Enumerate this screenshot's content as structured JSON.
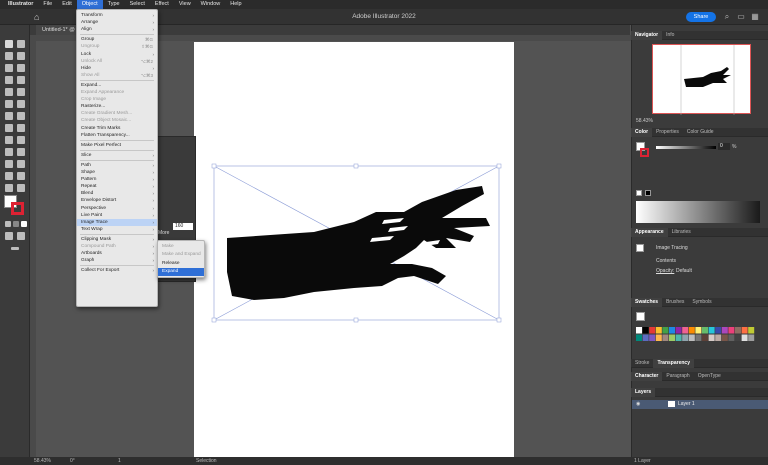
{
  "menubar": {
    "app": "Illustrator",
    "items": [
      "File",
      "Edit",
      "Object",
      "Type",
      "Select",
      "Effect",
      "View",
      "Window",
      "Help"
    ],
    "active": "Object"
  },
  "appbar": {
    "title": "Adobe Illustrator 2022",
    "share_label": "Share"
  },
  "document": {
    "tab_label": "Untitled-1* @"
  },
  "object_menu": {
    "items": [
      {
        "label": "Transform",
        "arrow": true
      },
      {
        "label": "Arrange",
        "arrow": true
      },
      {
        "label": "Align",
        "arrow": true
      },
      {
        "sep": true
      },
      {
        "label": "Group",
        "shortcut": "⌘G"
      },
      {
        "label": "Ungroup",
        "shortcut": "⇧⌘G",
        "disabled": true
      },
      {
        "label": "Lock",
        "arrow": true
      },
      {
        "label": "Unlock All",
        "shortcut": "⌥⌘2",
        "disabled": true
      },
      {
        "label": "Hide",
        "arrow": true
      },
      {
        "label": "Show All",
        "shortcut": "⌥⌘3",
        "disabled": true
      },
      {
        "sep": true
      },
      {
        "label": "Expand..."
      },
      {
        "label": "Expand Appearance",
        "disabled": true
      },
      {
        "label": "Crop Image",
        "disabled": true
      },
      {
        "label": "Rasterize..."
      },
      {
        "label": "Create Gradient Mesh...",
        "disabled": true
      },
      {
        "label": "Create Object Mosaic...",
        "disabled": true
      },
      {
        "label": "Create Trim Marks"
      },
      {
        "label": "Flatten Transparency..."
      },
      {
        "sep": true
      },
      {
        "label": "Make Pixel Perfect"
      },
      {
        "sep": true
      },
      {
        "label": "Slice",
        "arrow": true
      },
      {
        "sep": true
      },
      {
        "label": "Path",
        "arrow": true
      },
      {
        "label": "Shape",
        "arrow": true
      },
      {
        "label": "Pattern",
        "arrow": true
      },
      {
        "label": "Repeat",
        "arrow": true
      },
      {
        "label": "Blend",
        "arrow": true
      },
      {
        "label": "Envelope Distort",
        "arrow": true
      },
      {
        "label": "Perspective",
        "arrow": true
      },
      {
        "label": "Live Paint",
        "arrow": true
      },
      {
        "label": "Image Trace",
        "arrow": true,
        "highlighted": true
      },
      {
        "label": "Text Wrap",
        "arrow": true
      },
      {
        "sep": true
      },
      {
        "label": "Clipping Mask",
        "arrow": true
      },
      {
        "label": "Compound Path",
        "arrow": true,
        "disabled": true
      },
      {
        "label": "Artboards",
        "arrow": true
      },
      {
        "label": "Graph",
        "arrow": true
      },
      {
        "sep": true
      },
      {
        "label": "Collect For Export",
        "arrow": true
      }
    ]
  },
  "image_trace_submenu": {
    "items": [
      {
        "label": "Make",
        "disabled": true
      },
      {
        "label": "Make and Expand",
        "disabled": true
      },
      {
        "label": "Release"
      },
      {
        "label": "Expand",
        "selected": true
      }
    ]
  },
  "float_panel": {
    "more_label": "More",
    "value": "160"
  },
  "navigator_panel": {
    "tabs": [
      "Navigator",
      "Info"
    ],
    "zoom": "58.43%"
  },
  "color_panel": {
    "tabs": [
      "Color",
      "Properties",
      "Color Guide"
    ],
    "k_value": "0",
    "unit": "%"
  },
  "appearance_panel": {
    "tabs": [
      "Appearance",
      "Libraries"
    ],
    "rows": [
      "Image Tracing",
      "Contents"
    ],
    "opacity_label": "Opacity:",
    "opacity_value": "Default"
  },
  "swatches_panel": {
    "tabs": [
      "Swatches",
      "Brushes",
      "Symbols"
    ],
    "colors": [
      "#ffffff",
      "#000000",
      "#e53935",
      "#fbc02d",
      "#43a047",
      "#1e88e5",
      "#8e24aa",
      "#f06292",
      "#fb8c00",
      "#fff176",
      "#66bb6a",
      "#26c6da",
      "#3949ab",
      "#ab47bc",
      "#ec407a",
      "#8d6e63",
      "#ff7043",
      "#c0ca33",
      "#00897b",
      "#5c6bc0",
      "#7e57c2",
      "#ffb74d",
      "#a1887f",
      "#9ccc65",
      "#4db6ac",
      "#90a4ae",
      "#bdbdbd",
      "#757575",
      "#5d4037",
      "#d7ccc8",
      "#bcaaa4",
      "#795548",
      "#616161",
      "#424242",
      "#e0e0e0",
      "#9e9e9e"
    ]
  },
  "stroke_panel": {
    "tabs": [
      "Stroke",
      "Transparency"
    ]
  },
  "character_panel": {
    "tabs": [
      "Character",
      "Paragraph",
      "OpenType"
    ]
  },
  "layers_panel": {
    "tabs": [
      "Layers"
    ],
    "layers": [
      "Layer 1"
    ],
    "count_label": "1 Layer"
  },
  "status": {
    "zoom": "58.43%",
    "angle": "0°",
    "artboard": "1",
    "tool": "Selection"
  },
  "colors": {
    "accent": "#2f6fd6",
    "menu_bg": "#e8e8e8",
    "bounding_box": "#8a9bd6"
  }
}
